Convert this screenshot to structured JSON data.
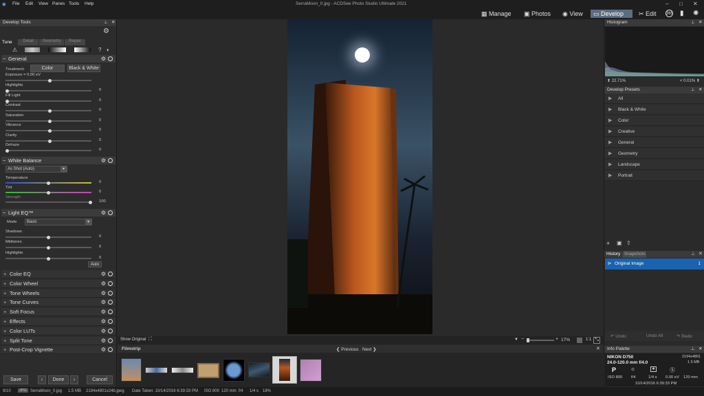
{
  "menu": [
    "File",
    "Edit",
    "View",
    "Panes",
    "Tools",
    "Help"
  ],
  "app_title": "SerraMoon_0.jpg - ACDSee Photo Studio Ultimate 2021",
  "modes": {
    "manage": "Manage",
    "photos": "Photos",
    "view": "View",
    "develop": "Develop",
    "edit": "Edit",
    "icon_365": "365"
  },
  "develop_tools": {
    "title": "Develop Tools",
    "tabs": [
      "Tune",
      "Detail",
      "Geometry",
      "Repair"
    ],
    "general": {
      "title": "General",
      "treatment_label": "Treatment:",
      "color_btn": "Color",
      "bw_btn": "Black & White",
      "sliders": [
        {
          "label": "Exposure = 0.00 eV",
          "value": ""
        },
        {
          "label": "Highlights",
          "value": "0"
        },
        {
          "label": "Fill Light",
          "value": "0"
        },
        {
          "label": "Contrast",
          "value": "0"
        },
        {
          "label": "Saturation",
          "value": "0"
        },
        {
          "label": "Vibrance",
          "value": "0"
        },
        {
          "label": "Clarity",
          "value": "0"
        },
        {
          "label": "Dehaze",
          "value": "0"
        }
      ]
    },
    "white_balance": {
      "title": "White Balance",
      "preset": "As Shot (Auto)",
      "temperature_label": "Temperature",
      "temperature_value": "0",
      "tint_label": "Tint",
      "tint_value": "0",
      "strength_label": "Strength",
      "strength_value": "100"
    },
    "lighteq": {
      "title": "Light EQ™",
      "mode_label": "Mode",
      "mode_value": "Basic",
      "sliders": [
        {
          "label": "Shadows",
          "value": "0"
        },
        {
          "label": "Midtones",
          "value": "0"
        },
        {
          "label": "Highlights",
          "value": "0"
        }
      ],
      "auto_btn": "Auto"
    },
    "collapsed_sections": [
      "Color EQ",
      "Color Wheel",
      "Tone Wheels",
      "Tone Curves",
      "Soft Focus",
      "Effects",
      "Color LUTs",
      "Split Tone",
      "Post-Crop Vignette"
    ],
    "save_btn": "Save",
    "done_btn": "Done",
    "cancel_btn": "Cancel"
  },
  "viewer": {
    "show_original": "Show Original",
    "zoom": "17%",
    "ratio": "1:1"
  },
  "filmstrip": {
    "title": "Filmstrip",
    "previous": "Previous",
    "next": "Next"
  },
  "histogram": {
    "title": "Histogram",
    "left_pct": "22.71%",
    "right_pct": "< 0.01%"
  },
  "develop_presets": {
    "title": "Develop Presets",
    "items": [
      "All",
      "Black & White",
      "Color",
      "Creative",
      "General",
      "Geometry",
      "Landscape",
      "Portrait"
    ]
  },
  "history": {
    "tab_history": "History",
    "tab_snapshots": "Snapshots",
    "item": "Original Image",
    "item_num": "1",
    "undo": "Undo",
    "undo_all": "Undo All",
    "redo": "Redo"
  },
  "info_palette": {
    "title": "Info Palette",
    "camera": "NIKON D750",
    "lens": "24.0-120.0 mm f/4.0",
    "dims": "2194x4801",
    "size": "1.5 MB",
    "mode": "P",
    "iso": "ISO 800",
    "aperture": "f/4",
    "shutter": "1/4 s",
    "ev": "0.00 eV",
    "focal": "120 mm",
    "date": "10/14/2016 6:39:33 PM"
  },
  "status": {
    "count": "9/10",
    "type": "JPG",
    "file": "SerraMoon_0.jpg",
    "size": "1.5 MB",
    "dims": "2194x4801x24b.jpeg",
    "date": "Date Taken: 10/14/2016 6:39:33 PM",
    "iso": "ISO 800",
    "focal": "120 mm",
    "fstop": "f/4",
    "shutter": "1/4 s",
    "zoom": "18%"
  }
}
